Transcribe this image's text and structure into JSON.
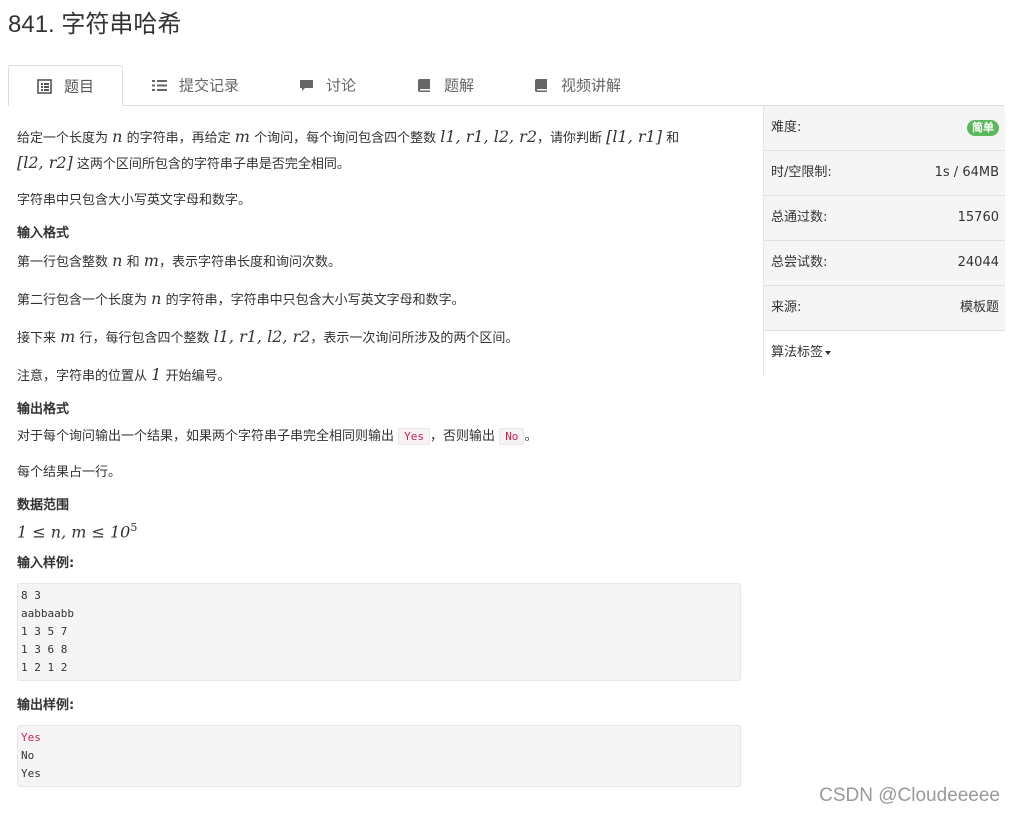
{
  "problem": {
    "title": "841. 字符串哈希"
  },
  "tabs": [
    {
      "label": "题目",
      "icon": "document-icon",
      "active": true
    },
    {
      "label": "提交记录",
      "icon": "list-icon"
    },
    {
      "label": "讨论",
      "icon": "comment-icon"
    },
    {
      "label": "题解",
      "icon": "book-icon"
    },
    {
      "label": "视频讲解",
      "icon": "book-icon"
    }
  ],
  "description": {
    "p1_a": "给定一个长度为",
    "p1_n": "n",
    "p1_b": "的字符串，再给定",
    "p1_m": "m",
    "p1_c": "个询问，每个询问包含四个整数",
    "p1_vars": "l1, r1, l2, r2",
    "p1_d": "，请你判断",
    "p1_range1": "[l1, r1]",
    "p1_e": "和",
    "p1_range2": "[l2, r2]",
    "p1_f": "这两个区间所包含的字符串子串是否完全相同。",
    "p2": "字符串中只包含大小写英文字母和数字。"
  },
  "input_format": {
    "heading": "输入格式",
    "l1_a": "第一行包含整数",
    "l1_n": "n",
    "l1_b": "和",
    "l1_m": "m",
    "l1_c": "，表示字符串长度和询问次数。",
    "l2_a": "第二行包含一个长度为",
    "l2_n": "n",
    "l2_b": "的字符串，字符串中只包含大小写英文字母和数字。",
    "l3_a": "接下来",
    "l3_m": "m",
    "l3_b": "行，每行包含四个整数",
    "l3_vars": "l1, r1, l2, r2",
    "l3_c": "，表示一次询问所涉及的两个区间。",
    "l4_a": "注意，字符串的位置从",
    "l4_one": "1",
    "l4_b": "开始编号。"
  },
  "output_format": {
    "heading": "输出格式",
    "l1_a": "对于每个询问输出一个结果，如果两个字符串子串完全相同则输出",
    "yes": "Yes",
    "l1_b": "，否则输出",
    "no": "No",
    "l1_c": "。",
    "l2": "每个结果占一行。"
  },
  "data_range": {
    "heading": "数据范围",
    "expr": "1 ≤ n, m ≤ 10",
    "exp": "5"
  },
  "sample_input": {
    "heading": "输入样例:",
    "lines": [
      "8 3",
      "aabbaabb",
      "1 3 5 7",
      "1 3 6 8",
      "1 2 1 2"
    ]
  },
  "sample_output": {
    "heading": "输出样例:",
    "lines": [
      "Yes",
      "No",
      "Yes"
    ]
  },
  "sidebar": {
    "difficulty_label": "难度:",
    "difficulty_value": "简单",
    "difficulty_color": "#5cb85c",
    "limit_label": "时/空限制:",
    "limit_value": "1s / 64MB",
    "passed_label": "总通过数:",
    "passed_value": "15760",
    "attempts_label": "总尝试数:",
    "attempts_value": "24044",
    "source_label": "来源:",
    "source_value": "模板题",
    "tags_label": "算法标签"
  },
  "watermark": "CSDN @Cloudeeeee"
}
